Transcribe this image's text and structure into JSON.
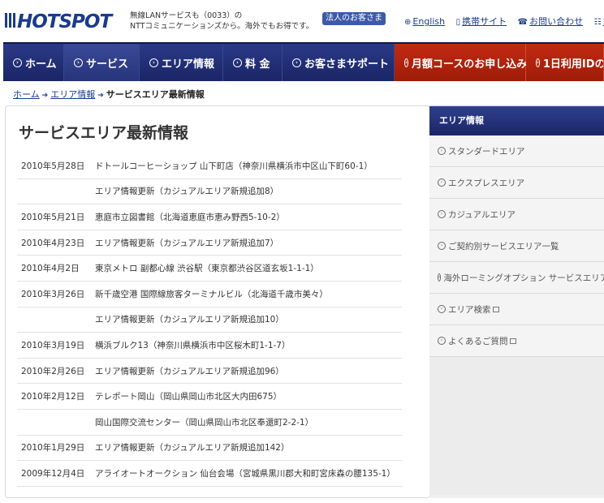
{
  "header": {
    "logo_text": "HOTSPOT",
    "tagline_line1": "無線LANサービスも（0033）の",
    "tagline_line2": "NTTコミュニケーションズから。海外でもお得です。",
    "corp_button": "法人のお客さま",
    "links": [
      {
        "icon": "globe-icon",
        "label": "English"
      },
      {
        "icon": "mobile-icon",
        "label": "携帯サイト"
      },
      {
        "icon": "phone-icon",
        "label": "お問い合わせ"
      },
      {
        "icon": "sitemap-icon",
        "label": "サ"
      }
    ]
  },
  "nav": {
    "items": [
      {
        "label": "ホーム",
        "style": "normal"
      },
      {
        "label": "サービス",
        "style": "active"
      },
      {
        "label": "エリア情報",
        "style": "normal"
      },
      {
        "label": "料 金",
        "style": "normal"
      },
      {
        "label": "お客さまサポート",
        "style": "normal"
      },
      {
        "label": "月額コースのお申し込み",
        "style": "red"
      },
      {
        "label": "1日利用IDの",
        "style": "red"
      }
    ]
  },
  "breadcrumb": {
    "home": "ホーム",
    "area": "エリア情報",
    "current": "サービスエリア最新情報"
  },
  "main": {
    "title": "サービスエリア最新情報",
    "news": [
      {
        "date": "2010年5月28日",
        "text": "ドトールコーヒーショップ 山下町店（神奈川県横浜市中区山下町60-1）"
      },
      {
        "date": "",
        "text": "エリア情報更新（カジュアルエリア新規追加8）"
      },
      {
        "date": "2010年5月21日",
        "text": "恵庭市立図書館（北海道恵庭市恵み野西5-10-2）"
      },
      {
        "date": "2010年4月23日",
        "text": "エリア情報更新（カジュアルエリア新規追加7）"
      },
      {
        "date": "2010年4月2日",
        "text": "東京メトロ 副都心線 渋谷駅（東京都渋谷区道玄坂1-1-1）"
      },
      {
        "date": "2010年3月26日",
        "text": "新千歳空港 国際線旅客ターミナルビル（北海道千歳市美々）"
      },
      {
        "date": "",
        "text": "エリア情報更新（カジュアルエリア新規追加10）"
      },
      {
        "date": "2010年3月19日",
        "text": "横浜ブルク13（神奈川県横浜市中区桜木町1-1-7）"
      },
      {
        "date": "2010年2月26日",
        "text": "エリア情報更新（カジュアルエリア新規追加96）"
      },
      {
        "date": "2010年2月12日",
        "text": "テレポート岡山（岡山県岡山市北区大内田675）"
      },
      {
        "date": "",
        "text": "岡山国際交流センター（岡山県岡山市北区奉還町2-2-1）"
      },
      {
        "date": "2010年1月29日",
        "text": "エリア情報更新（カジュアルエリア新規追加142）"
      },
      {
        "date": "2009年12月4日",
        "text": "アライオートオークション 仙台会場（宮城県黒川郡大和町宮床森の腰135-1）"
      }
    ]
  },
  "sidebar": {
    "heading": "エリア情報",
    "items": [
      {
        "label": "スタンダードエリア",
        "external": false
      },
      {
        "label": "エクスプレスエリア",
        "external": false
      },
      {
        "label": "カジュアルエリア",
        "external": false
      },
      {
        "label": "ご契約別サービスエリア一覧",
        "external": false
      },
      {
        "label": "海外ローミングオプション サービスエリア",
        "external": false
      },
      {
        "label": "エリア検索",
        "external": true
      },
      {
        "label": "よくあるご質問",
        "external": true
      }
    ]
  },
  "colors": {
    "nav_bg": "#1d2a6e",
    "nav_red": "#c22a12",
    "link": "#1a3b8c",
    "logo_blue": "#1a3b8c"
  }
}
